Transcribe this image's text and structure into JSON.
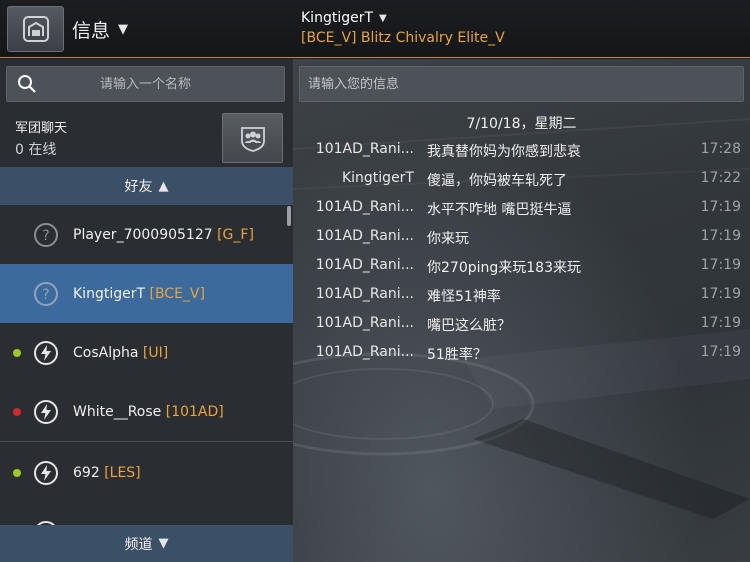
{
  "header": {
    "section_title": "信息",
    "chat_user": "KingtigerT",
    "chat_clan": "[BCE_V] Blitz Chivalry Elite_V"
  },
  "sidebar": {
    "search_placeholder": "请输入一个名称",
    "legion": {
      "name": "军团聊天",
      "online": "0 在线"
    },
    "friends_label": "好友",
    "channels_label": "频道",
    "friends": [
      {
        "name": "Player_7000905127",
        "clan": "[G_F]",
        "status": "unknown",
        "status_color": "",
        "selected": false
      },
      {
        "name": "KingtigerT",
        "clan": "[BCE_V]",
        "status": "unknown",
        "status_color": "",
        "selected": true
      },
      {
        "name": "CosAlpha",
        "clan": "[UI]",
        "status": "online",
        "status_color": "#9acb21",
        "selected": false
      },
      {
        "name": "White__Rose",
        "clan": "[101AD]",
        "status": "busy",
        "status_color": "#d0282c",
        "selected": false
      },
      {
        "name": "692",
        "clan": "[LES]",
        "status": "online",
        "status_color": "#9acb21",
        "selected": false
      }
    ]
  },
  "chat": {
    "input_placeholder": "请输入您的信息",
    "date": "7/10/18，星期二",
    "messages": [
      {
        "sender": "101AD_Rani...",
        "text": "我真替你妈为你感到悲哀",
        "time": "17:28"
      },
      {
        "sender": "KingtigerT",
        "text": "傻逼，你妈被车轧死了",
        "time": "17:22"
      },
      {
        "sender": "101AD_Rani...",
        "text": "水平不咋地 嘴巴挺牛逼",
        "time": "17:19"
      },
      {
        "sender": "101AD_Rani...",
        "text": "你来玩",
        "time": "17:19"
      },
      {
        "sender": "101AD_Rani...",
        "text": "你270ping来玩183来玩",
        "time": "17:19"
      },
      {
        "sender": "101AD_Rani...",
        "text": "难怪51神率",
        "time": "17:19"
      },
      {
        "sender": "101AD_Rani...",
        "text": "嘴巴这么脏？",
        "time": "17:19"
      },
      {
        "sender": "101AD_Rani...",
        "text": "51胜率？",
        "time": "17:19"
      }
    ]
  },
  "colors": {
    "accent": "#e9a43a",
    "selected": "#3d6a9c",
    "header_bar": "#3b4f66"
  }
}
